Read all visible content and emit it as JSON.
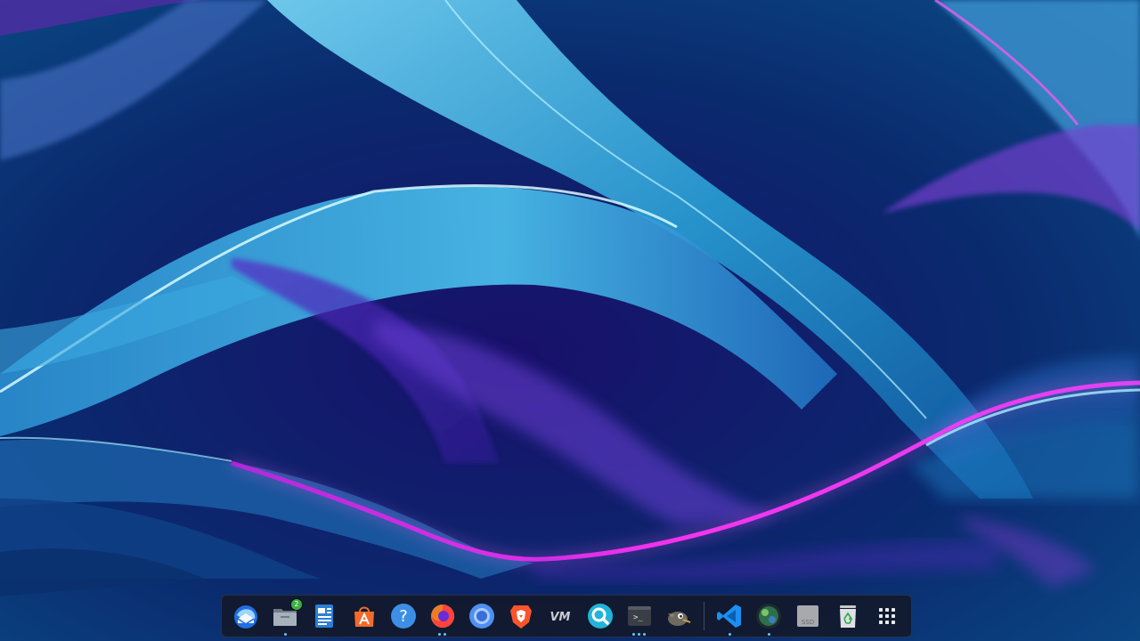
{
  "desktop": {
    "wallpaper": {
      "colors": {
        "deep": "#061236",
        "cyan": "#3fb4e6",
        "light_cyan": "#8ee6ff",
        "magenta": "#e81cf0",
        "violet": "#6a2bd0"
      }
    }
  },
  "dock": {
    "accent_color": "#5fc7ff",
    "items": [
      {
        "name": "thunderbird",
        "icon": "thunderbird-icon",
        "running": 0
      },
      {
        "name": "files",
        "icon": "folder-icon",
        "running": 1,
        "badge": "2"
      },
      {
        "name": "text-editor",
        "icon": "document-icon",
        "running": 0
      },
      {
        "name": "app-center",
        "icon": "app-store-icon",
        "running": 0
      },
      {
        "name": "help",
        "icon": "help-icon",
        "running": 0,
        "label": "?"
      },
      {
        "name": "firefox",
        "icon": "firefox-icon",
        "running": 2
      },
      {
        "name": "chromium",
        "icon": "chromium-icon",
        "running": 0
      },
      {
        "name": "brave",
        "icon": "brave-icon",
        "running": 0
      },
      {
        "name": "vm-manager",
        "icon": "vm-icon",
        "running": 0,
        "label": "VM"
      },
      {
        "name": "search-tool",
        "icon": "magnifier-icon",
        "running": 0
      },
      {
        "name": "terminal",
        "icon": "terminal-icon",
        "running": 3,
        "label": ">_"
      },
      {
        "name": "gimp",
        "icon": "gimp-icon",
        "running": 0
      },
      {
        "name": "vscode",
        "icon": "vscode-icon",
        "running": 1
      },
      {
        "name": "disk-usage",
        "icon": "globe-icon",
        "running": 1
      },
      {
        "name": "ssd-drive",
        "icon": "drive-icon",
        "running": 0,
        "label": "SSD"
      },
      {
        "name": "trash",
        "icon": "trash-icon",
        "running": 0
      },
      {
        "name": "show-apps",
        "icon": "apps-grid-icon",
        "running": 0
      }
    ]
  }
}
